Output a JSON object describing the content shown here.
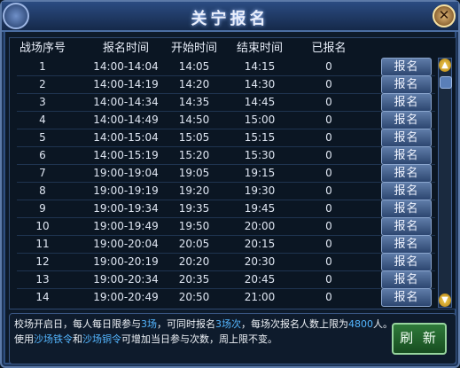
{
  "window": {
    "title": "关宁报名",
    "close_label": "✕"
  },
  "table": {
    "headers": [
      "战场序号",
      "报名时间",
      "开始时间",
      "结束时间",
      "已报名"
    ],
    "rows": [
      {
        "index": "1",
        "signup": "14:00-14:04",
        "start": "14:05",
        "end": "14:15",
        "count": "0",
        "button": "报名"
      },
      {
        "index": "2",
        "signup": "14:00-14:19",
        "start": "14:20",
        "end": "14:30",
        "count": "0",
        "button": "报名"
      },
      {
        "index": "3",
        "signup": "14:00-14:34",
        "start": "14:35",
        "end": "14:45",
        "count": "0",
        "button": "报名"
      },
      {
        "index": "4",
        "signup": "14:00-14:49",
        "start": "14:50",
        "end": "15:00",
        "count": "0",
        "button": "报名"
      },
      {
        "index": "5",
        "signup": "14:00-15:04",
        "start": "15:05",
        "end": "15:15",
        "count": "0",
        "button": "报名"
      },
      {
        "index": "6",
        "signup": "14:00-15:19",
        "start": "15:20",
        "end": "15:30",
        "count": "0",
        "button": "报名"
      },
      {
        "index": "7",
        "signup": "19:00-19:04",
        "start": "19:05",
        "end": "19:15",
        "count": "0",
        "button": "报名"
      },
      {
        "index": "8",
        "signup": "19:00-19:19",
        "start": "19:20",
        "end": "19:30",
        "count": "0",
        "button": "报名"
      },
      {
        "index": "9",
        "signup": "19:00-19:34",
        "start": "19:35",
        "end": "19:45",
        "count": "0",
        "button": "报名"
      },
      {
        "index": "10",
        "signup": "19:00-19:49",
        "start": "19:50",
        "end": "20:00",
        "count": "0",
        "button": "报名"
      },
      {
        "index": "11",
        "signup": "19:00-20:04",
        "start": "20:05",
        "end": "20:15",
        "count": "0",
        "button": "报名"
      },
      {
        "index": "12",
        "signup": "19:00-20:19",
        "start": "20:20",
        "end": "20:30",
        "count": "0",
        "button": "报名"
      },
      {
        "index": "13",
        "signup": "19:00-20:34",
        "start": "20:35",
        "end": "20:45",
        "count": "0",
        "button": "报名"
      },
      {
        "index": "14",
        "signup": "19:00-20:49",
        "start": "20:50",
        "end": "21:00",
        "count": "0",
        "button": "报名"
      }
    ]
  },
  "scrollbar": {
    "up_icon": "▲",
    "down_icon": "▼"
  },
  "footer": {
    "text_1": "校场开启日，每人每日限参与",
    "text_2": "3场",
    "text_3": "，可同时报名",
    "text_4": "3场次",
    "text_5": "，每场次报名人数上限为",
    "text_6": "4800",
    "text_7": "人。使用",
    "text_8": "沙场铁令",
    "text_9": "和",
    "text_10": "沙场铜令",
    "text_11": "可增加当日参与次数，周上限不变。",
    "refresh_label": "刷 新"
  },
  "colors": {
    "highlight": "#54b6ff",
    "refresh_green": "#2f7a3a",
    "button_blue": "#5f7ca8"
  }
}
